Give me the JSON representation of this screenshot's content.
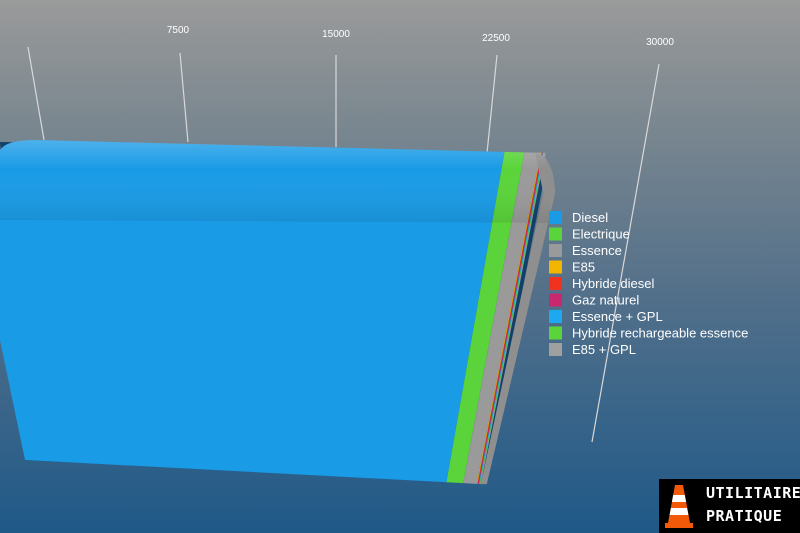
{
  "chart_data": {
    "type": "bar",
    "orientation": "horizontal-stacked-3d",
    "x_ticks": [
      "7500",
      "15000",
      "22500",
      "30000"
    ],
    "xlim": [
      0,
      30000
    ],
    "categories": [
      ""
    ],
    "series": [
      {
        "name": "Diesel",
        "values": [
          25000
        ],
        "color": "#1a9be6"
      },
      {
        "name": "Electrique",
        "values": [
          1000
        ],
        "color": "#5ad43a"
      },
      {
        "name": "Essence",
        "values": [
          800
        ],
        "color": "#9a9a9a"
      },
      {
        "name": "E85",
        "values": [
          25
        ],
        "color": "#f2b600"
      },
      {
        "name": "Hybride diesel",
        "values": [
          20
        ],
        "color": "#f0321e"
      },
      {
        "name": "Gaz naturel",
        "values": [
          15
        ],
        "color": "#c8286e"
      },
      {
        "name": "Essence + GPL",
        "values": [
          10
        ],
        "color": "#1ea8f0"
      },
      {
        "name": "Hybride rechargeable essence",
        "values": [
          8
        ],
        "color": "#5ad43a"
      },
      {
        "name": "E85 + GPL",
        "values": [
          5
        ],
        "color": "#a0a0a0"
      }
    ],
    "legend_position": "right"
  },
  "logo": {
    "line1": "UTILITAIRE",
    "line2": "PRATIQUE"
  }
}
